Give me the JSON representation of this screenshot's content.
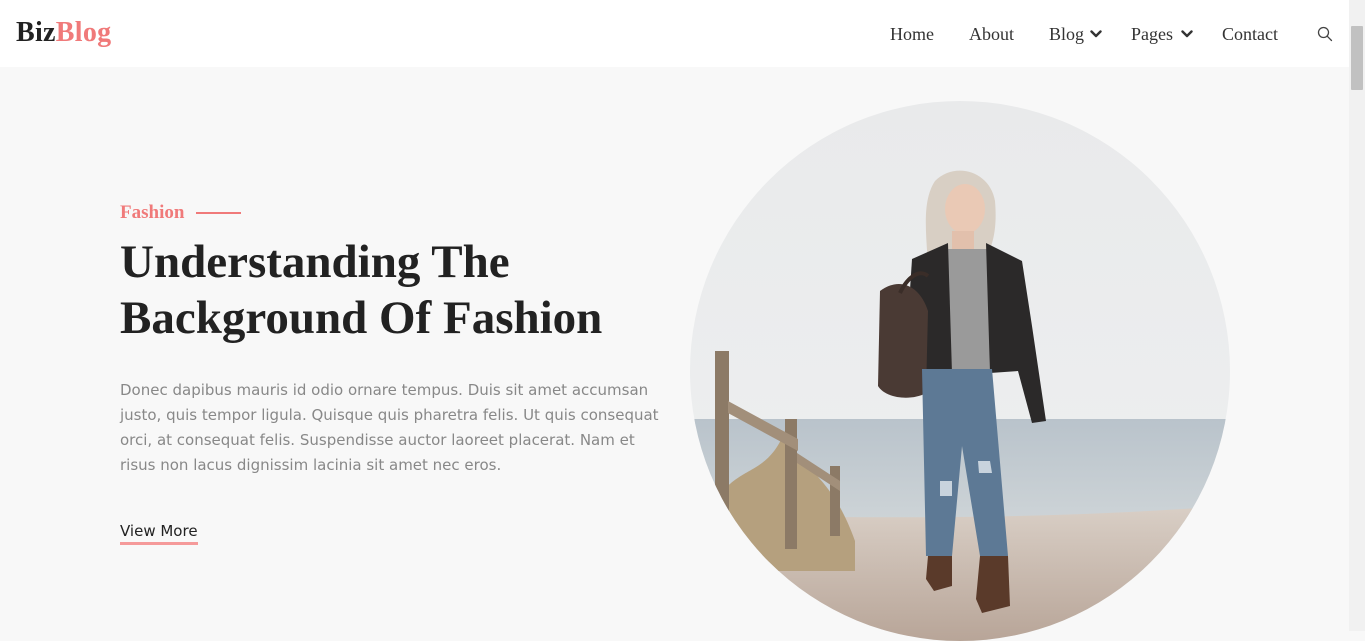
{
  "brand": {
    "part1": "Biz",
    "part2": "Blog"
  },
  "nav": {
    "items": [
      {
        "label": "Home"
      },
      {
        "label": "About"
      },
      {
        "label": "Blog",
        "icon": "chevron-down-icon"
      },
      {
        "label": "Pages",
        "icon": "chevron-down-icon"
      },
      {
        "label": "Contact"
      }
    ],
    "search_icon": "search-icon"
  },
  "hero": {
    "category": "Fashion",
    "title_line1": "Understanding The",
    "title_line2": "Background Of Fashion",
    "excerpt": "Donec dapibus mauris id odio ornare tempus. Duis sit amet accumsan justo, quis tempor ligula. Quisque quis pharetra felis. Ut quis consequat orci, at consequat felis. Suspendisse auctor laoreet placerat. Nam et risus non lacus dignissim lacinia sit amet nec eros.",
    "cta": "View More"
  },
  "colors": {
    "accent": "#f07a7a",
    "text_dark": "#222222",
    "text_muted": "#888888",
    "background": "#f8f8f8"
  }
}
